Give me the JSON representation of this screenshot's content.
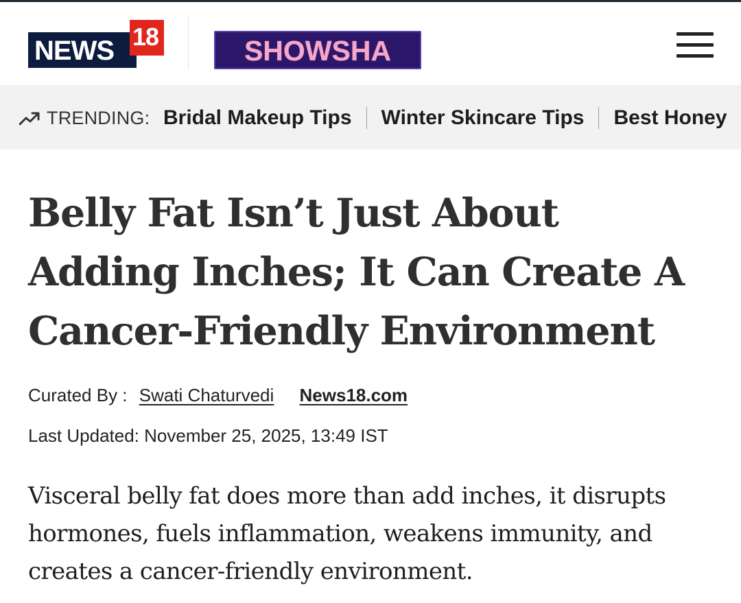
{
  "header": {
    "logo_news": "NEWS",
    "logo_number": "18",
    "logo_showsha": "SHOWSHA",
    "menu_icon": "hamburger-menu-icon"
  },
  "trending": {
    "icon": "trending-up-icon",
    "label": "TRENDING:",
    "items": [
      {
        "label": "Bridal Makeup Tips"
      },
      {
        "label": "Winter Skincare Tips"
      },
      {
        "label": "Best Honey"
      }
    ]
  },
  "article": {
    "headline_lines": [
      "Belly Fat Isn’t Just About",
      "Adding Inches; It Can Create A",
      "Cancer-Friendly Environment"
    ],
    "curated_label": "Curated By :",
    "author": "Swati Chaturvedi",
    "source": "News18.com",
    "updated_label": "Last Updated:",
    "updated_value": "November 25, 2025, 13:49 IST",
    "summary_lines": [
      "Visceral belly fat does more than add inches, it disrupts",
      "hormones, fuels inflammation, weakens immunity, and",
      "creates a cancer-friendly environment."
    ]
  },
  "colors": {
    "news18_navy": "#0d1b3e",
    "news18_red": "#e1261c",
    "showsha_bg": "#2b1769",
    "showsha_text": "#f2a9c9",
    "trending_bg": "#f2f2f2"
  }
}
